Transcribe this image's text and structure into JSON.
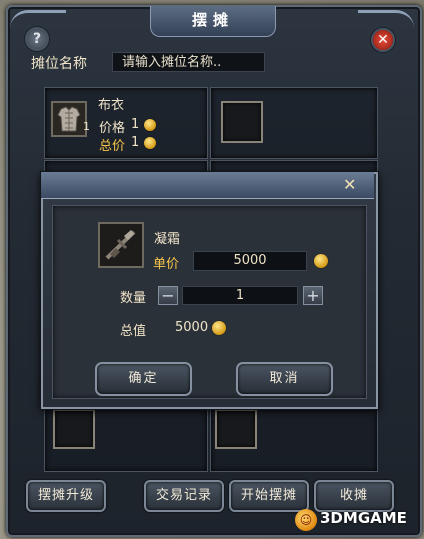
{
  "window": {
    "title": "摆摊",
    "help_glyph": "?",
    "close_glyph": "✕"
  },
  "stall": {
    "name_label": "摊位名称",
    "name_placeholder": "请输入摊位名称.."
  },
  "slots": [
    {
      "item_name": "布衣",
      "quantity": "1",
      "price_label": "价格",
      "price_value": "1",
      "total_label": "总价",
      "total_value": "1",
      "icon": "cloth-armor-icon"
    }
  ],
  "dialog": {
    "close_glyph": "✕",
    "item_name": "凝霜",
    "item_icon": "crossbow-icon",
    "unit_price_label": "单价",
    "unit_price_value": "5000",
    "quantity_label": "数量",
    "quantity_value": "1",
    "minus_glyph": "−",
    "plus_glyph": "+",
    "total_label": "总值",
    "total_value": "5000",
    "confirm_label": "确定",
    "cancel_label": "取消"
  },
  "bottom_bar": {
    "upgrade_label": "摆摊升级",
    "trade_log_label": "交易记录",
    "start_label": "开始摆摊",
    "close_stall_label": "收摊"
  },
  "watermark": {
    "logo_glyph": "☺",
    "text": "3DMGAME"
  },
  "colors": {
    "accent_gold": "#f6c44a",
    "text_cream": "#f0e4c8",
    "close_red": "#c0281a"
  }
}
